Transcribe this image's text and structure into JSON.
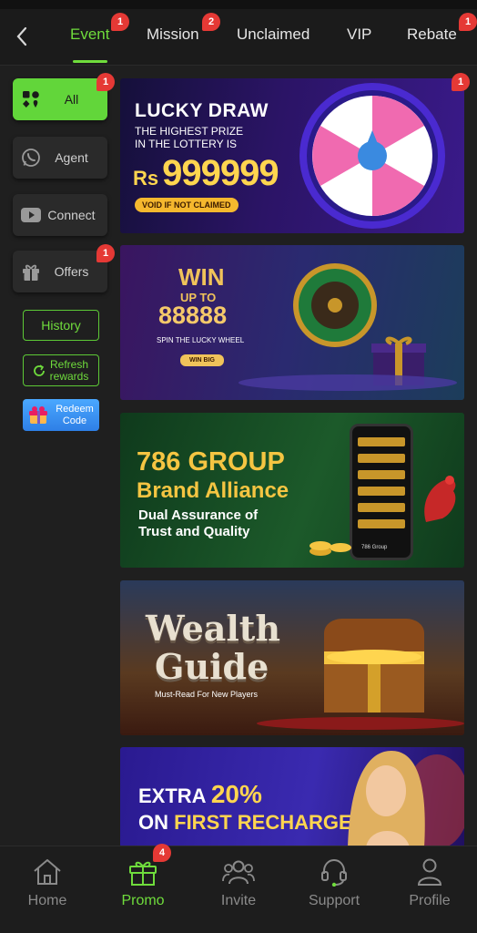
{
  "header": {
    "tabs": [
      {
        "label": "Event",
        "badge": "1"
      },
      {
        "label": "Mission",
        "badge": "2"
      },
      {
        "label": "Unclaimed"
      },
      {
        "label": "VIP"
      },
      {
        "label": "Rebate",
        "badge": "1"
      }
    ],
    "active_tab": "Event",
    "back_icon": "chevron-left-icon"
  },
  "sidebar": {
    "items": [
      {
        "label": "All",
        "icon": "grid-suits-icon",
        "badge": "1",
        "active": true
      },
      {
        "label": "Agent",
        "icon": "whatsapp-icon"
      },
      {
        "label": "Connect",
        "icon": "youtube-icon"
      },
      {
        "label": "Offers",
        "icon": "gift-icon",
        "badge": "1"
      }
    ],
    "history_label": "History",
    "refresh_label": "Refresh rewards",
    "refresh_line1": "Refresh",
    "refresh_line2": "rewards",
    "redeem_line1": "Redeem",
    "redeem_line2": "Code"
  },
  "banners": {
    "b1": {
      "title": "LUCKY DRAW",
      "line1": "THE HIGHEST PRIZE",
      "line2": "IN THE LOTTERY IS",
      "currency": "Rs",
      "amount": "999999",
      "note": "VOID IF NOT CLAIMED",
      "badge": "1"
    },
    "b2": {
      "win": "WIN",
      "upto": "UP TO",
      "amount": "88888",
      "sub": "SPIN THE LUCKY WHEEL",
      "button": "WIN BIG"
    },
    "b3": {
      "l1": "786 GROUP",
      "l2": "Brand Alliance",
      "l3": "Dual Assurance of",
      "l4": "Trust and Quality",
      "phone_label": "786 Group"
    },
    "b4": {
      "l1": "Wealth",
      "l2": "Guide",
      "sub": "Must-Read For New Players"
    },
    "b5": {
      "l1a": "EXTRA ",
      "l1b": "20%",
      "l2a": "ON ",
      "l2b": "FIRST RECHARGE"
    }
  },
  "bottom_nav": {
    "items": [
      {
        "label": "Home",
        "icon": "home-icon"
      },
      {
        "label": "Promo",
        "icon": "gift-icon",
        "badge": "4",
        "active": true
      },
      {
        "label": "Invite",
        "icon": "people-icon"
      },
      {
        "label": "Support",
        "icon": "headset-icon"
      },
      {
        "label": "Profile",
        "icon": "person-icon"
      }
    ]
  },
  "colors": {
    "accent": "#6fdc3c",
    "badge": "#e53935",
    "background": "#1f1f1f"
  }
}
